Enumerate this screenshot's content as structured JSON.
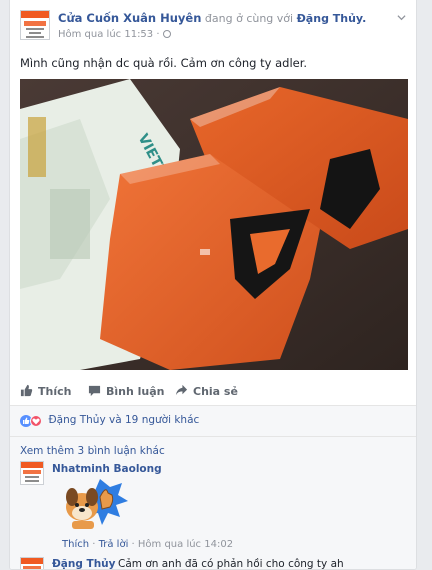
{
  "post": {
    "page_name": "Cửa Cuốn Xuân Huyên",
    "with_text": " đang ở cùng với ",
    "tagged_name": "Đặng Thủy.",
    "timestamp": "Hôm qua lúc 11:53 ·",
    "text": "Mình cũng nhận dc quà rồi. Cảm ơn công ty adler."
  },
  "photo": {
    "bag_brand_text": "VIETTEL"
  },
  "actions": {
    "like": "Thích",
    "comment": "Bình luận",
    "share": "Chia sẻ"
  },
  "reactions": {
    "summary": "Đặng Thủy và 19 người khác"
  },
  "comments": {
    "more": "Xem thêm 3 bình luận khác",
    "items": [
      {
        "author": "Nhatminh Baolong",
        "like": "Thích",
        "reply": "Trả lời",
        "time": "Hôm qua lúc 14:02"
      },
      {
        "author": "Đặng Thủy",
        "text": "Cảm ơn anh đã có phản hồi cho công ty ah"
      }
    ]
  },
  "colors": {
    "link": "#365899",
    "meta": "#90949c",
    "accent": "#f05a22"
  }
}
